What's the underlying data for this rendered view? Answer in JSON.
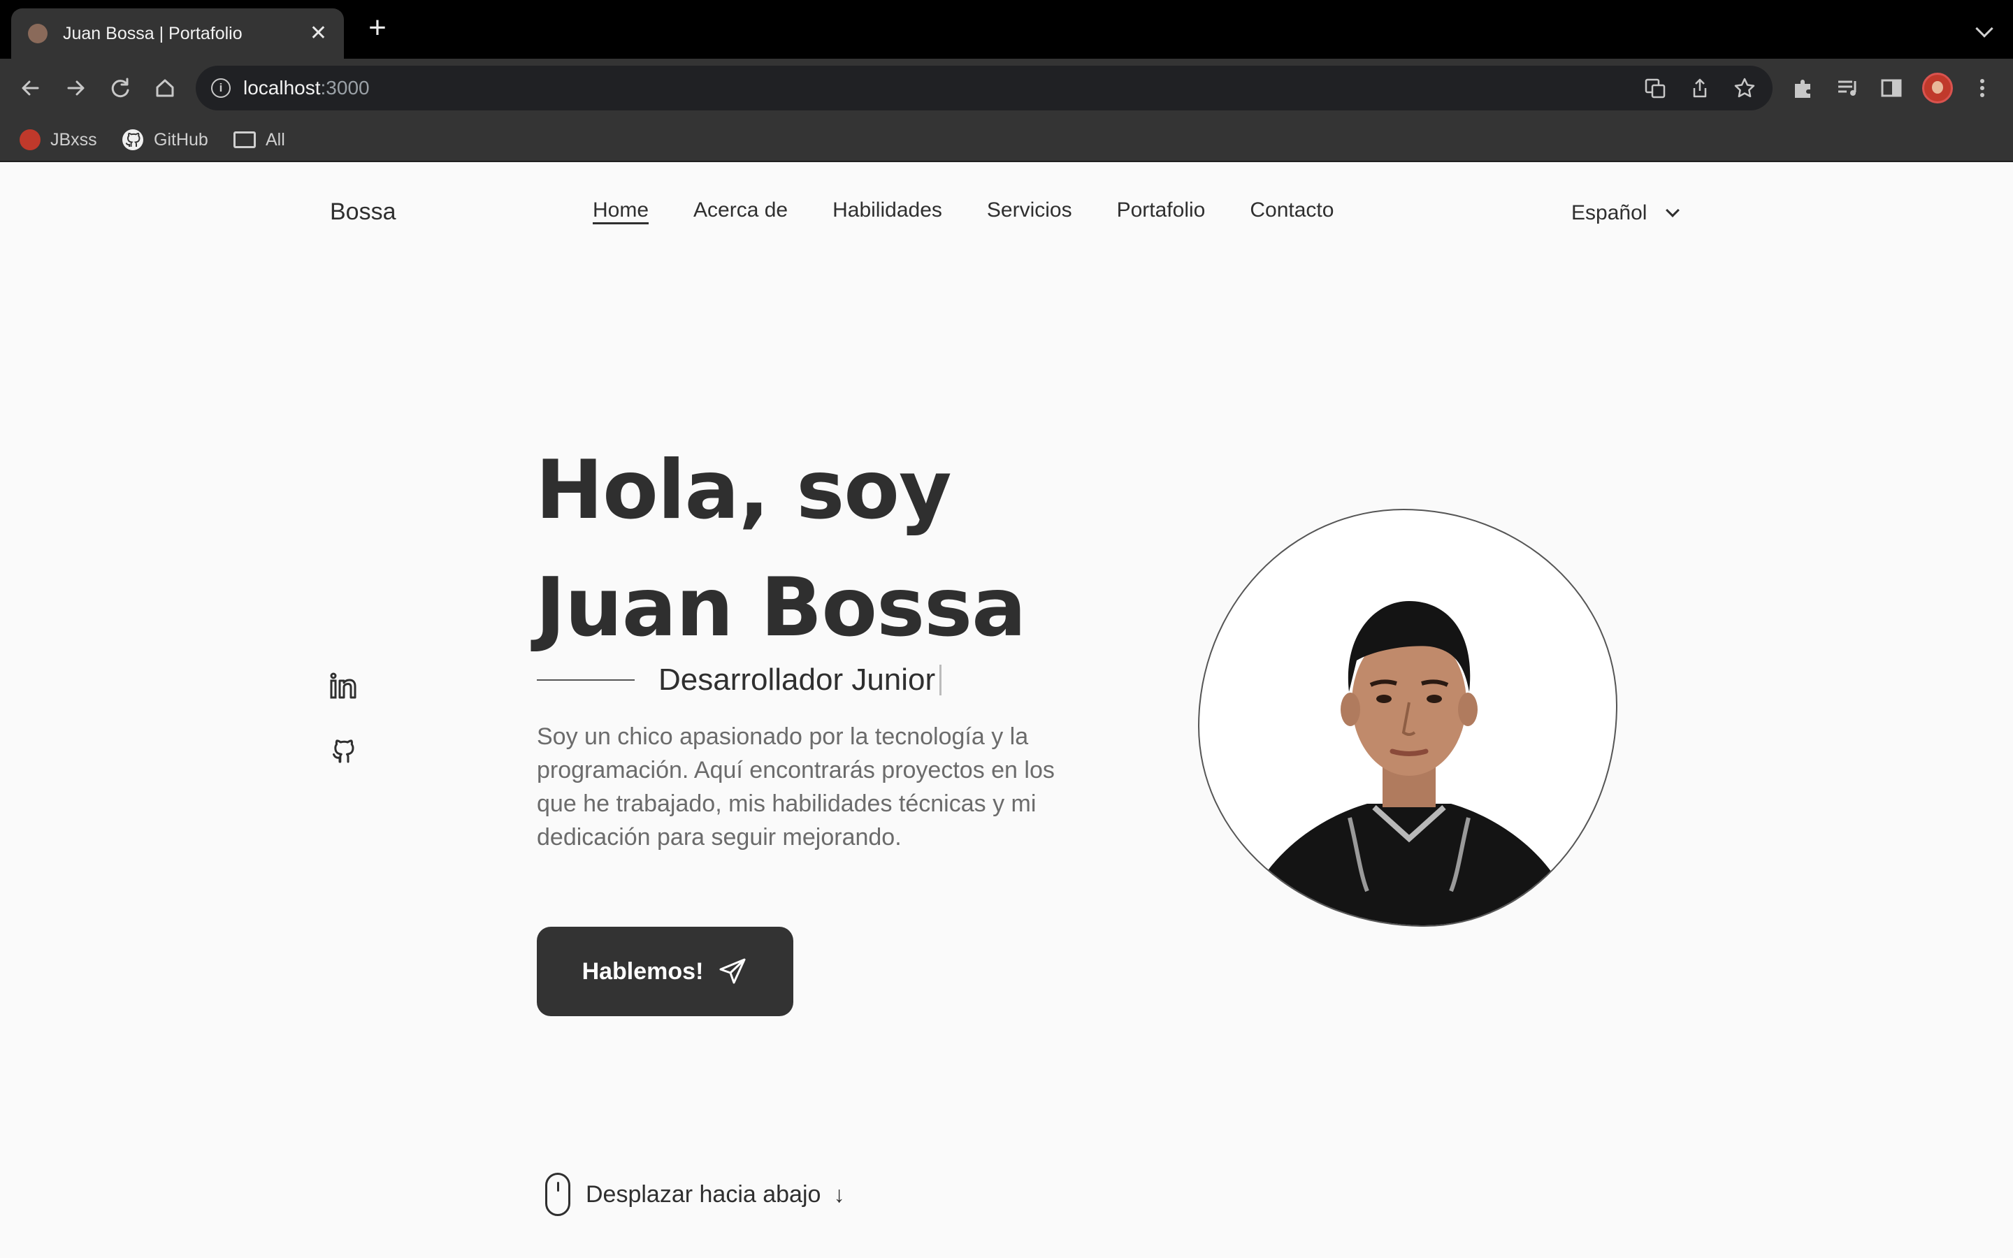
{
  "browser": {
    "tab_title": "Juan Bossa | Portafolio",
    "tab_close": "✕",
    "new_tab": "+",
    "url_host": "localhost",
    "url_port": ":3000",
    "bookmarks": [
      {
        "label": "JBxss",
        "icon": "avatar-icon"
      },
      {
        "label": "GitHub",
        "icon": "github-icon"
      },
      {
        "label": "All",
        "icon": "folder-icon"
      }
    ]
  },
  "header": {
    "brand": "Bossa",
    "nav": [
      "Home",
      "Acerca de",
      "Habilidades",
      "Servicios",
      "Portafolio",
      "Contacto"
    ],
    "active_nav": "Home",
    "language": "Español"
  },
  "hero": {
    "title_line1": "Hola, soy",
    "title_line2": "Juan Bossa",
    "subtitle": "Desarrollador Junior",
    "description": "Soy un chico apasionado por la tecnología y la programación. Aquí encontrarás proyectos en los que he trabajado, mis habilidades técnicas y mi dedicación para seguir mejorando.",
    "cta_label": "Hablemos!",
    "social": [
      "linkedin-icon",
      "github-icon"
    ],
    "photo": "profile-photo"
  },
  "scroll": {
    "label": "Desplazar hacia abajo",
    "arrow": "↓"
  },
  "colors": {
    "page_bg": "#fafafa",
    "text": "#2f2f2f",
    "muted_text": "#6b6b6b",
    "button_bg": "#333333",
    "chrome_dark": "#000000",
    "chrome_toolbar": "#343434"
  }
}
